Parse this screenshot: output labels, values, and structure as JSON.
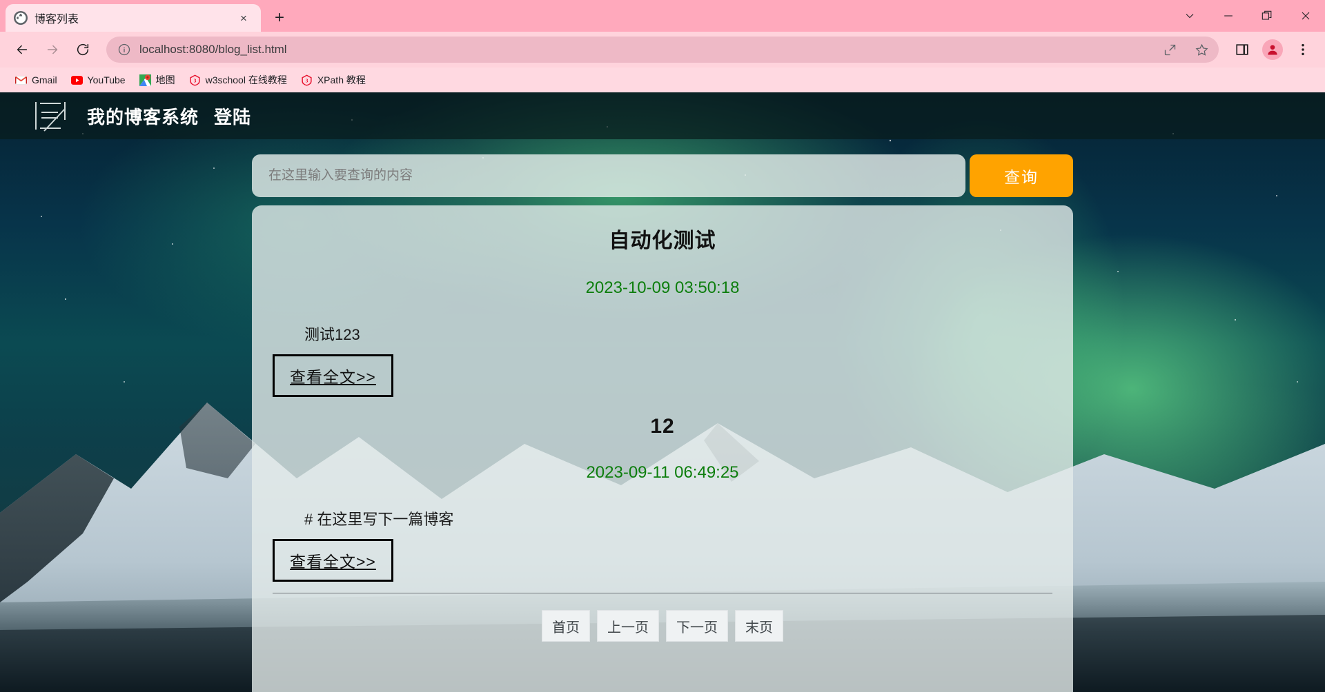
{
  "browser": {
    "tab": {
      "title": "博客列表",
      "favicon": "globe-icon",
      "close_label": "×"
    },
    "new_tab_label": "+",
    "window_controls": [
      "chevron-down-icon",
      "minimize-icon",
      "restore-icon",
      "close-icon"
    ],
    "nav": {
      "back": "←",
      "forward": "→",
      "reload": "⟳"
    },
    "omnibox": {
      "url": "localhost:8080/blog_list.html",
      "info_icon": "info-circle-icon"
    },
    "toolbar_icons": [
      "share-icon",
      "star-icon",
      "side-panel-icon",
      "profile-avatar",
      "three-dot-menu-icon"
    ],
    "bookmarks": [
      {
        "label": "Gmail",
        "icon": "gmail-icon"
      },
      {
        "label": "YouTube",
        "icon": "youtube-icon"
      },
      {
        "label": "地图",
        "icon": "google-maps-icon"
      },
      {
        "label": "w3school 在线教程",
        "icon": "w3school-icon"
      },
      {
        "label": "XPath 教程",
        "icon": "w3school-icon"
      }
    ]
  },
  "page": {
    "header": {
      "logo": "blog-logo-icon",
      "site_title": "我的博客系统",
      "login_label": "登陆"
    },
    "search": {
      "placeholder": "在这里输入要查询的内容",
      "value": "",
      "button_label": "查询",
      "button_color": "#ffa300"
    },
    "blogs": [
      {
        "title": "自动化测试",
        "date": "2023-10-09 03:50:18",
        "desc": "测试123",
        "more_label": "查看全文>>"
      },
      {
        "title": "12",
        "date": "2023-09-11 06:49:25",
        "desc": "# 在这里写下一篇博客",
        "more_label": "查看全文>>"
      }
    ],
    "pagination": [
      {
        "label": "首页"
      },
      {
        "label": "上一页"
      },
      {
        "label": "下一页"
      },
      {
        "label": "末页"
      }
    ],
    "colors": {
      "date_green": "#0d7e0d",
      "accent_orange": "#ffa300",
      "card_bg": "rgba(228,235,234,0.80)"
    }
  }
}
